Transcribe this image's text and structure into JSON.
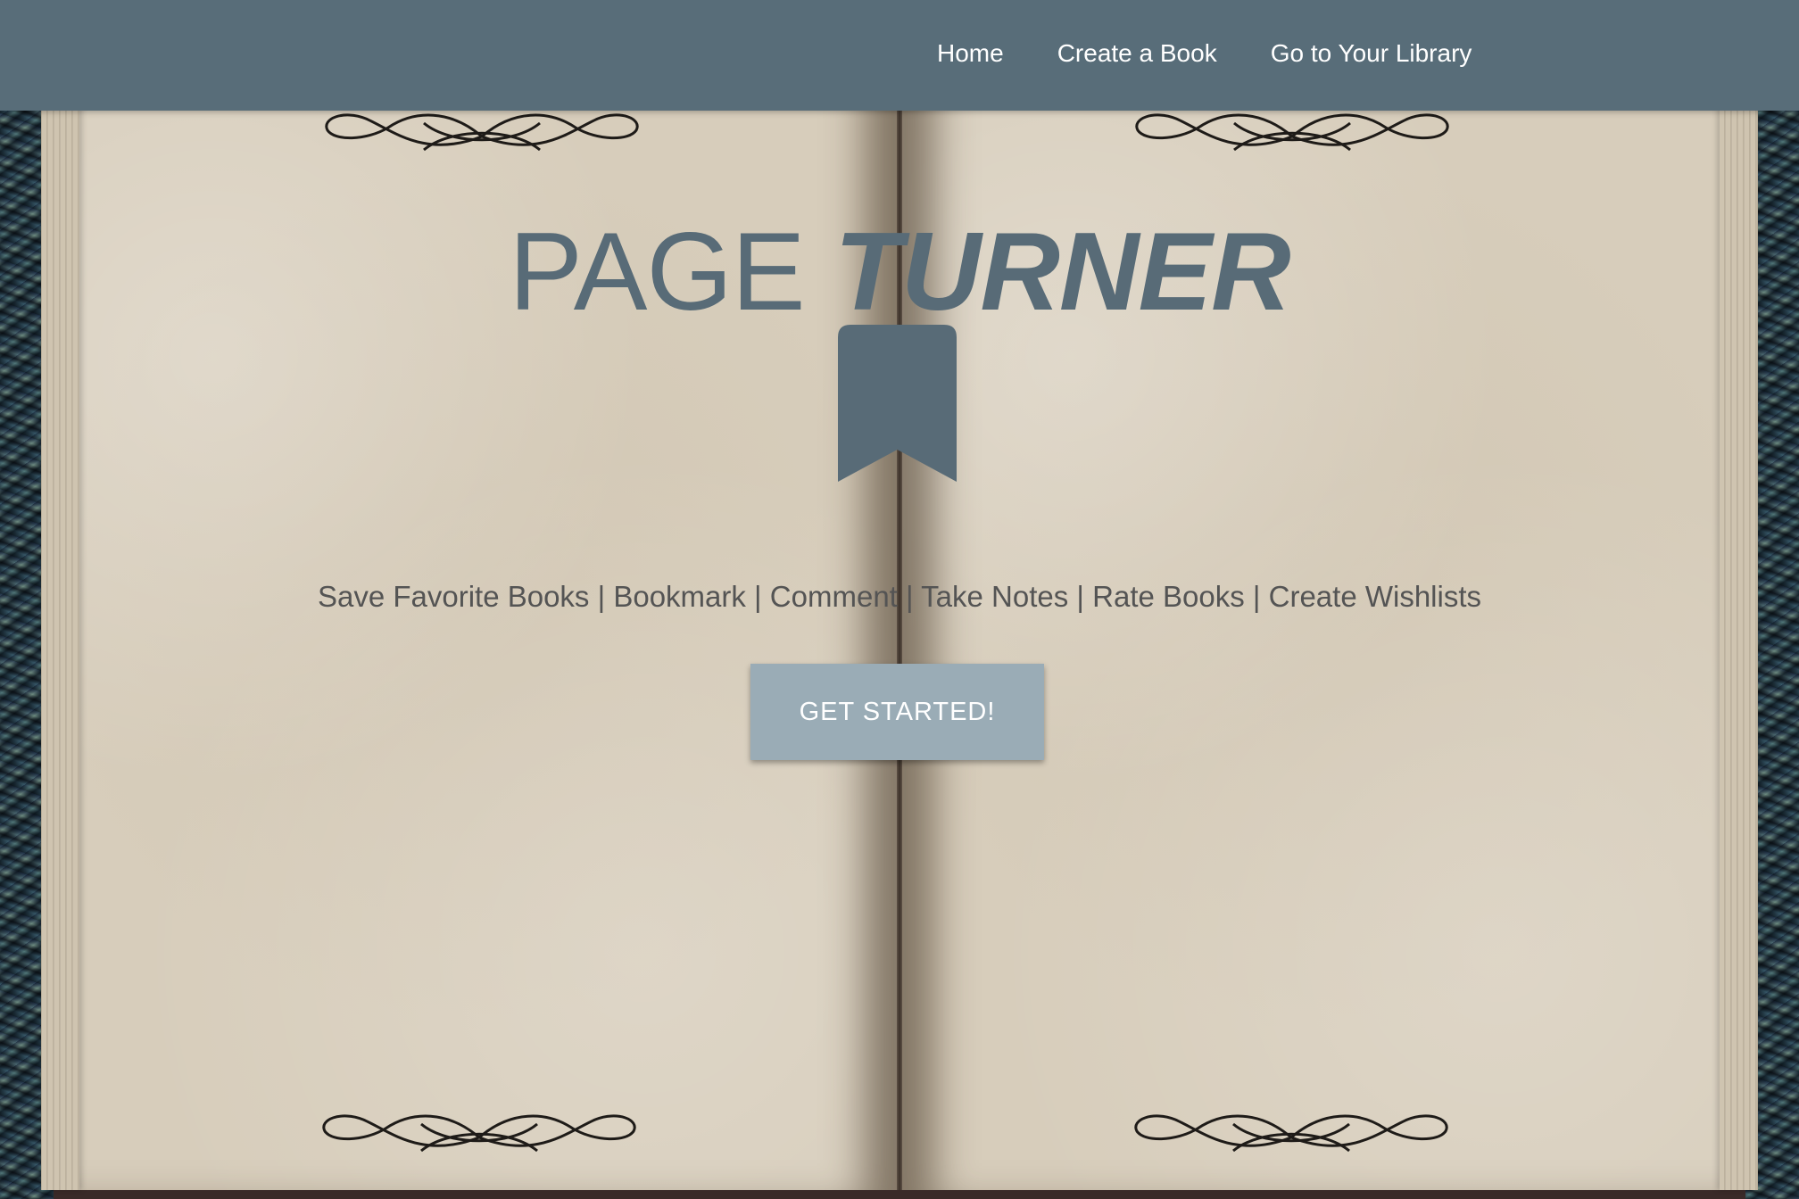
{
  "navbar": {
    "links": [
      {
        "label": "Home"
      },
      {
        "label": "Create a Book"
      },
      {
        "label": "Go to Your Library"
      }
    ]
  },
  "hero": {
    "title_part1": "PAGE",
    "title_part2": "TURNER",
    "features": "Save Favorite Books | Bookmark | Comment | Take Notes | Rate Books | Create Wishlists",
    "cta_label": "GET STARTED!",
    "bookmark_icon": "bookmark-icon"
  },
  "colors": {
    "navbar_bg": "#586d79",
    "title": "#586b77",
    "button_bg": "#9aacb6",
    "page": "#d7cdbb"
  }
}
